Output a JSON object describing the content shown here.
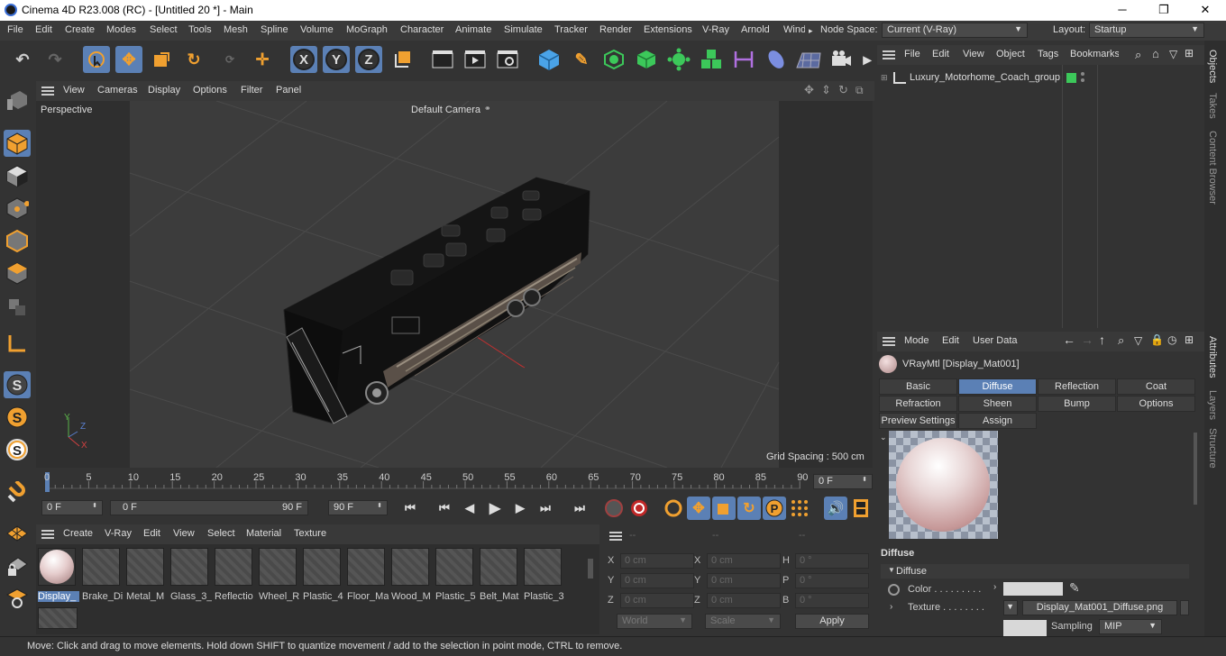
{
  "titlebar": {
    "title": "Cinema 4D R23.008 (RC) - [Untitled 20 *] - Main",
    "minimize": "─",
    "maximize": "❐",
    "close": "✕"
  },
  "menubar": {
    "items": [
      "File",
      "Edit",
      "Create",
      "Modes",
      "Select",
      "Tools",
      "Mesh",
      "Spline",
      "Volume",
      "MoGraph",
      "Character",
      "Animate",
      "Simulate",
      "Tracker",
      "Render",
      "Extensions",
      "V-Ray",
      "Arnold",
      "Wind"
    ],
    "overflow": "▸",
    "node_space_label": "Node Space:",
    "node_space_value": "Current (V-Ray)",
    "layout_label": "Layout:",
    "layout_value": "Startup"
  },
  "viewport": {
    "menu": [
      "View",
      "Cameras",
      "Display",
      "Options",
      "Filter",
      "Panel"
    ],
    "label": "Perspective",
    "camera": "Default Camera",
    "grid_spacing": "Grid Spacing : 500 cm",
    "axis_y": "Y",
    "axis_z": "Z",
    "axis_x": "X"
  },
  "timeline": {
    "ticks": [
      "0",
      "5",
      "10",
      "15",
      "20",
      "25",
      "30",
      "35",
      "40",
      "45",
      "50",
      "55",
      "60",
      "65",
      "70",
      "75",
      "80",
      "85",
      "90"
    ],
    "current_frame": "0 F"
  },
  "transport": {
    "start": "0 F",
    "range_start": "0 F",
    "range_end": "90 F",
    "end": "90 F"
  },
  "materials": {
    "menu": [
      "Create",
      "V-Ray",
      "Edit",
      "View",
      "Select",
      "Material",
      "Texture"
    ],
    "items": [
      "Display_",
      "Brake_Di",
      "Metal_M",
      "Glass_3_",
      "Reflectio",
      "Wheel_R",
      "Plastic_4",
      "Floor_Ma",
      "Wood_M",
      "Plastic_5",
      "Belt_Mat",
      "Plastic_3"
    ]
  },
  "coords": {
    "header": [
      "--",
      "--",
      "--"
    ],
    "rows": [
      {
        "a": "X",
        "av": "0 cm",
        "b": "X",
        "bv": "0 cm",
        "c": "H",
        "cv": "0 °"
      },
      {
        "a": "Y",
        "av": "0 cm",
        "b": "Y",
        "bv": "0 cm",
        "c": "P",
        "cv": "0 °"
      },
      {
        "a": "Z",
        "av": "0 cm",
        "b": "Z",
        "bv": "0 cm",
        "c": "B",
        "cv": "0 °"
      }
    ],
    "world": "World",
    "scale": "Scale",
    "apply": "Apply"
  },
  "objects": {
    "menu": [
      "File",
      "Edit",
      "View",
      "Object",
      "Tags",
      "Bookmarks"
    ],
    "item": "Luxury_Motorhome_Coach_group"
  },
  "attributes": {
    "menu": [
      "Mode",
      "Edit",
      "User Data"
    ],
    "material_name": "VRayMtl [Display_Mat001]",
    "tabs_row1": [
      "Basic",
      "Diffuse",
      "Reflection",
      "Coat"
    ],
    "tabs_row2": [
      "Refraction",
      "Sheen",
      "Bump",
      "Options"
    ],
    "tabs_row3": [
      "Preview Settings",
      "Assign"
    ],
    "section": "Diffuse",
    "subsection": "Diffuse",
    "color_label": "Color . . . . . . . . .",
    "texture_label": "Texture . . . . . . . .",
    "texture_file": "Display_Mat001_Diffuse.png",
    "sampling_label": "Sampling",
    "sampling_value": "MIP"
  },
  "right_tabs": [
    "Objects",
    "Takes",
    "Content Browser",
    "Attributes",
    "Layers",
    "Structure"
  ],
  "status": "Move: Click and drag to move elements. Hold down SHIFT to quantize movement / add to the selection in point mode, CTRL to remove.",
  "colors": {
    "accent": "#5b80b5",
    "icon_orange": "#f0a030",
    "icon_green": "#3cc85a"
  }
}
